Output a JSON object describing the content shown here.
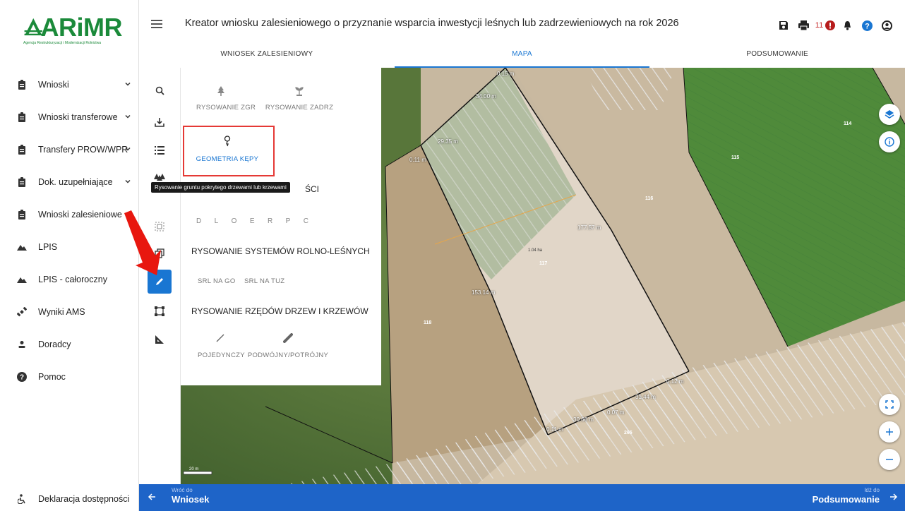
{
  "logo": {
    "text": "ARiMR",
    "subtitle": "Agencja Restrukturyzacji i Modernizacji Rolnictwa"
  },
  "sidebar": {
    "items": [
      {
        "label": "Wnioski",
        "icon": "clipboard-icon",
        "has_chevron": true
      },
      {
        "label": "Wnioski transferowe",
        "icon": "clipboard-icon",
        "has_chevron": true
      },
      {
        "label": "Transfery PROW/WPR",
        "icon": "clipboard-icon",
        "has_chevron": true
      },
      {
        "label": "Dok. uzupełniające",
        "icon": "clipboard-icon",
        "has_chevron": true
      },
      {
        "label": "Wnioski zalesieniowe",
        "icon": "clipboard-icon",
        "has_chevron": true
      },
      {
        "label": "LPIS",
        "icon": "mountain-icon",
        "has_chevron": false
      },
      {
        "label": "LPIS - całoroczny",
        "icon": "mountain-icon",
        "has_chevron": false
      },
      {
        "label": "Wyniki AMS",
        "icon": "satellite-icon",
        "has_chevron": false
      },
      {
        "label": "Doradcy",
        "icon": "person-icon",
        "has_chevron": false
      },
      {
        "label": "Pomoc",
        "icon": "help-icon",
        "has_chevron": false
      }
    ],
    "footer": {
      "label": "Deklaracja dostępności",
      "icon": "accessibility-icon"
    }
  },
  "header": {
    "title": "Kreator wniosku zalesieniowego o przyznanie wsparcia inwestycji leśnych lub zadrzewieniowych na rok 2026",
    "error_count": "11"
  },
  "tabs": [
    {
      "label": "WNIOSEK ZALESIENIOWY",
      "active": false
    },
    {
      "label": "MAPA",
      "active": true
    },
    {
      "label": "PODSUMOWANIE",
      "active": false
    }
  ],
  "panel": {
    "tools_top": [
      {
        "label": "RYSOWANIE ZGR",
        "icon": "tree-icon"
      },
      {
        "label": "RYSOWANIE ZADRZ",
        "icon": "sapling-icon"
      }
    ],
    "highlight_tool": {
      "label": "GEOMETRIA KĘPY",
      "icon": "key-pin-icon"
    },
    "tooltip": "Rysowanie gruntu pokrytego drzewami lub krzewami",
    "tooltip_trailing": "ŚCI",
    "letters": [
      "D",
      "L",
      "O",
      "E",
      "R",
      "P",
      "C"
    ],
    "section_srl": "RYSOWANIE SYSTEMÓW ROLNO-LEŚNYCH",
    "srl_tools": [
      "SRL NA GO",
      "SRL NA TUZ"
    ],
    "section_rows": "RYSOWANIE RZĘDÓW DRZEW I KRZEWÓW",
    "row_tools": [
      {
        "label": "POJEDYNCZY",
        "icon": "single-line-icon"
      },
      {
        "label": "PODWÓJNY/POTRÓJNY",
        "icon": "double-line-icon"
      }
    ]
  },
  "map": {
    "parcel_labels": [
      "114",
      "115",
      "116",
      "117",
      "118",
      "265"
    ],
    "measures": [
      "0.15 m",
      "34.00 m",
      "29.35 m",
      "0.11 m",
      "177.57 m",
      "1.04 ha",
      "153.14 m",
      "0.12 m",
      "31.44 m",
      "0.07 m",
      "30.66 m",
      "0.11 m"
    ],
    "scale": "20 m"
  },
  "bottom": {
    "back_small": "Wróć do",
    "back_big": "Wniosek",
    "next_small": "Idź do",
    "next_big": "Podsumowanie"
  }
}
